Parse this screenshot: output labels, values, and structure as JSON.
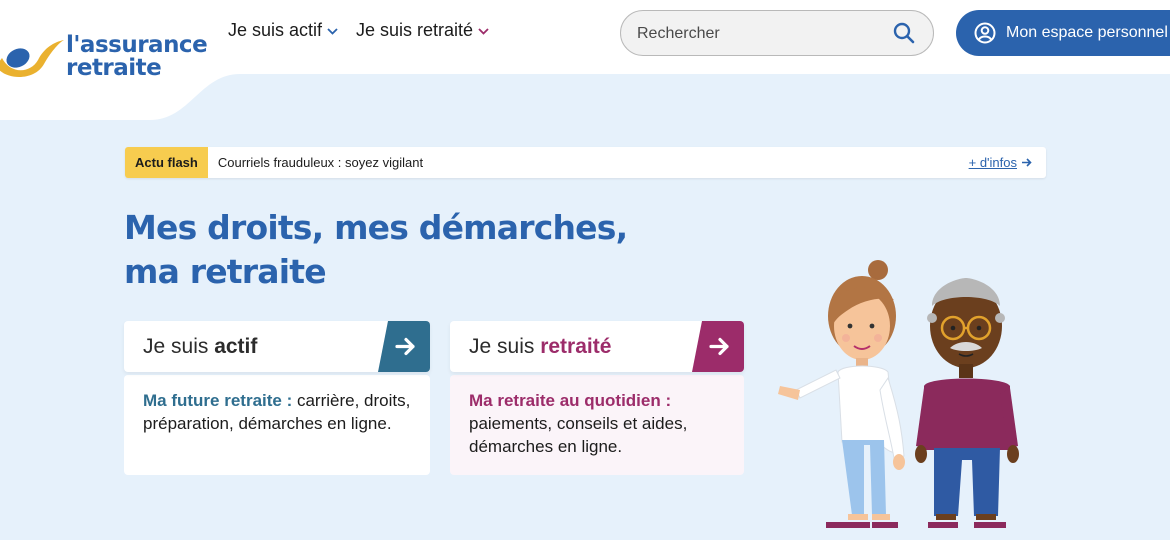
{
  "header": {
    "logo": {
      "line1": "l'assurance",
      "line2": "retraite"
    },
    "nav": [
      {
        "label": "Je suis actif",
        "chevron_color": "#2b63ad"
      },
      {
        "label": "Je suis retraité",
        "chevron_color": "#9c2c6a"
      }
    ],
    "search": {
      "placeholder": "Rechercher",
      "value": "",
      "icon": "search-icon"
    },
    "account_button": {
      "label": "Mon espace personnel",
      "icon": "user-circle-icon"
    }
  },
  "flash": {
    "badge": "Actu flash",
    "text": "Courriels frauduleux : soyez vigilant",
    "link": "+ d'infos"
  },
  "hero": {
    "title_line1": "Mes droits, mes démarches,",
    "title_line2": "ma retraite"
  },
  "cards": [
    {
      "prefix": "Je suis",
      "emphasis": "actif",
      "body_strong": "Ma future retraite :",
      "body_text": " carrière, droits, préparation, démarches en ligne.",
      "accent": "#2f6e8f"
    },
    {
      "prefix": "Je suis",
      "emphasis": "retraité",
      "body_strong": "Ma retraite au quotidien :",
      "body_text": " paiements, conseils et aides, démarches en ligne.",
      "accent": "#9c2c6a"
    }
  ],
  "colors": {
    "brand_blue": "#2b63ad",
    "background": "#e6f1fb",
    "flash_yellow": "#f7cc4f",
    "actif_accent": "#2f6e8f",
    "retraite_accent": "#9c2c6a"
  }
}
